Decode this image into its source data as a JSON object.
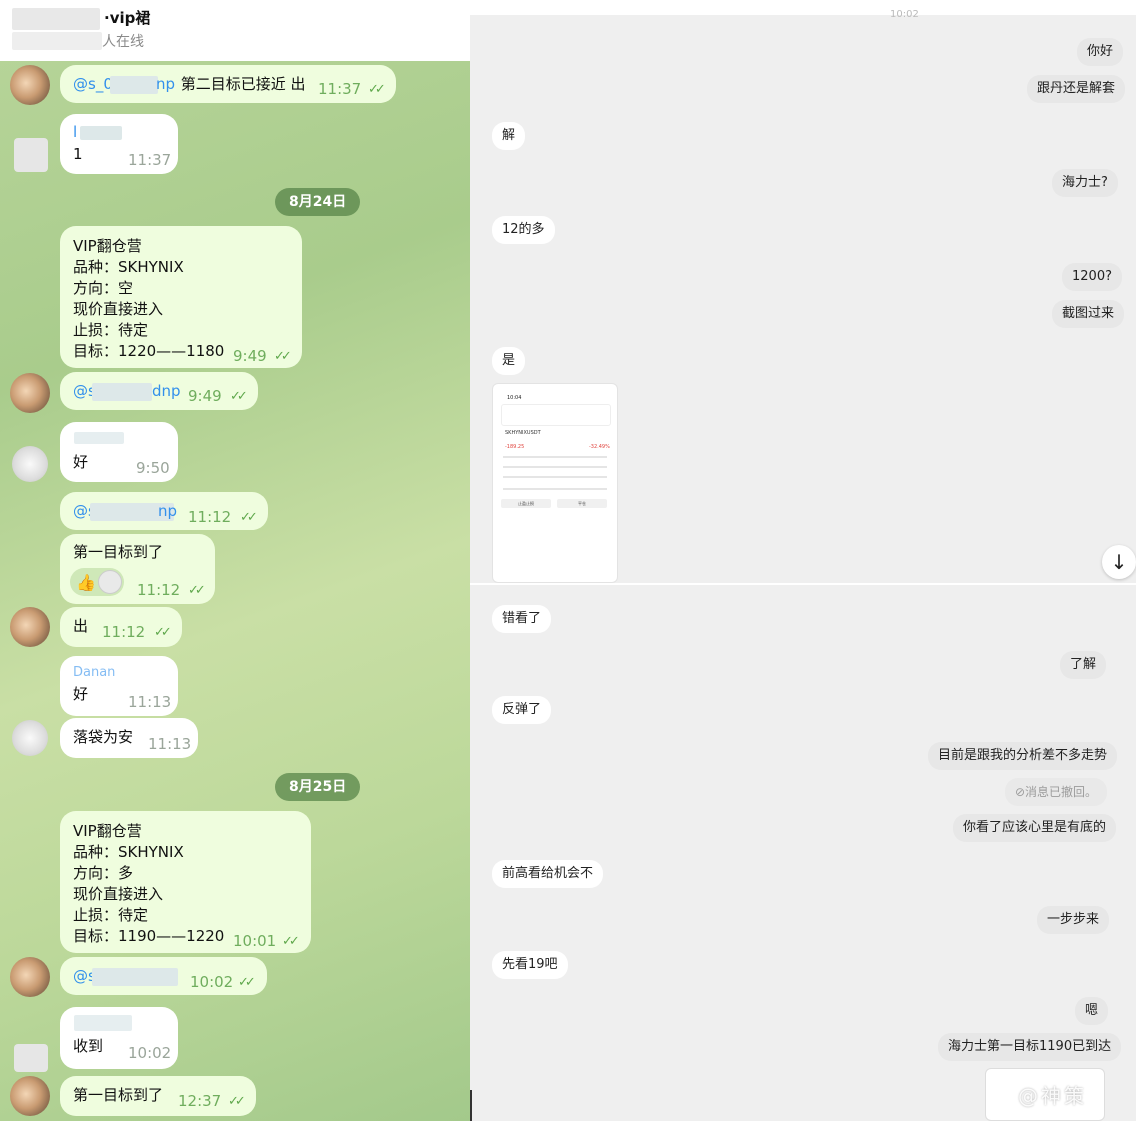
{
  "left_chat": {
    "title_suffix": "·vip裙",
    "status": "人在线",
    "messages": [
      {
        "mention_start": "@s_0",
        "mention_end": "np",
        "text": " 第二目标已接近 出",
        "time": "11:37"
      },
      {
        "first_line": "l",
        "text": "1",
        "time": "11:37"
      },
      {
        "date": "8月24日"
      },
      {
        "lines": [
          "VIP翻仓营",
          "品种：SKHYNIX",
          "方向：空",
          "现价直接进入",
          "止损：待定",
          "目标：1220——1180"
        ],
        "time": "9:49"
      },
      {
        "mention_start": "@s",
        "mention_end": "dnp",
        "time": "9:49"
      },
      {
        "text": "好",
        "time": "9:50"
      },
      {
        "mention_start": "@s",
        "mention_end": "np",
        "time": "11:12"
      },
      {
        "text": "第一目标到了",
        "time": "11:12"
      },
      {
        "text": "出",
        "time": "11:12"
      },
      {
        "name": "Danan",
        "text": "好",
        "time": "11:13"
      },
      {
        "text": "落袋为安",
        "time": "11:13"
      },
      {
        "date": "8月25日"
      },
      {
        "lines": [
          "VIP翻仓营",
          "品种：SKHYNIX",
          "方向：多",
          "现价直接进入",
          "止损：待定",
          "目标：1190——1220"
        ],
        "time": "10:01"
      },
      {
        "mention_start": "@s",
        "time": "10:02"
      },
      {
        "text": "收到",
        "time": "10:02"
      },
      {
        "text": "第一目标到了",
        "time": "12:37"
      }
    ]
  },
  "right_chat": {
    "top_time": "10:02",
    "messages_top": [
      {
        "side": "right",
        "text": "你好"
      },
      {
        "side": "right",
        "text": "跟丹还是解套"
      },
      {
        "side": "left",
        "text": "解"
      },
      {
        "side": "right",
        "text": "海力士?"
      },
      {
        "side": "left",
        "text": "12的多"
      },
      {
        "side": "right",
        "text": "1200?"
      },
      {
        "side": "right",
        "text": "截图过来"
      },
      {
        "side": "left",
        "text": "是"
      }
    ],
    "screenshot": {
      "status_time": "10:04",
      "symbol": "SKHYNIXUSDT",
      "pnl": "-189.25",
      "pct": "-32.49%",
      "btn_left": "止盈止损",
      "btn_right": "平仓"
    },
    "messages_bottom": [
      {
        "side": "left",
        "text": "错看了"
      },
      {
        "side": "right",
        "text": "了解"
      },
      {
        "side": "left",
        "text": "反弹了"
      },
      {
        "side": "right",
        "text": "目前是跟我的分析差不多走势"
      },
      {
        "side": "right",
        "text": "⊘消息已撤回。",
        "recalled": true
      },
      {
        "side": "right",
        "text": "你看了应该心里是有底的"
      },
      {
        "side": "left",
        "text": "前高看给机会不"
      },
      {
        "side": "right",
        "text": "一步步来"
      },
      {
        "side": "left",
        "text": "先看19吧"
      },
      {
        "side": "right",
        "text": "嗯"
      },
      {
        "side": "right",
        "text": "海力士第一目标1190已到达"
      }
    ],
    "scroll_down_icon": "↓",
    "watermark": "@神策"
  },
  "colors": {
    "bubble": "#effdde",
    "accent": "#3390ec",
    "time": "#6fad5d"
  }
}
